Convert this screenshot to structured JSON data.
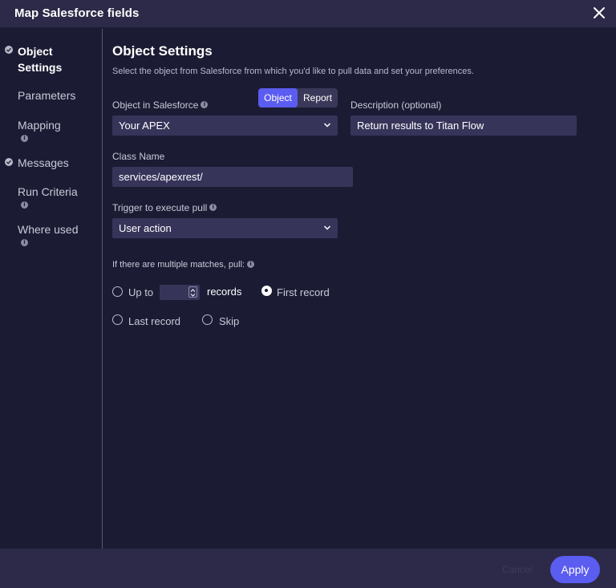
{
  "window": {
    "title": "Map Salesforce fields"
  },
  "sidebar": {
    "items": [
      {
        "label": "Object Settings",
        "checked": true,
        "active": true
      },
      {
        "label": "Parameters"
      },
      {
        "label": "Mapping",
        "info": true
      },
      {
        "label": "Messages",
        "checked": true
      },
      {
        "label": "Run Criteria",
        "info": true
      },
      {
        "label": "Where used",
        "info": true
      }
    ]
  },
  "main": {
    "title": "Object Settings",
    "subtitle": "Select the object from Salesforce from which you'd like to pull data and set your preferences.",
    "object_label": "Object in Salesforce",
    "toggle": {
      "object": "Object",
      "report": "Report",
      "selected": "Object"
    },
    "object_value": "Your APEX",
    "description_label": "Description (optional)",
    "description_value": "Return results to Titan Flow",
    "class_label": "Class Name",
    "class_value": "services/apexrest/",
    "trigger_label": "Trigger to execute pull",
    "trigger_value": "User action",
    "matches_label": "If there are multiple matches, pull:",
    "options": {
      "up_to": "Up to",
      "up_to_value": "",
      "records": "records",
      "first_record": "First record",
      "last_record": "Last record",
      "skip": "Skip",
      "selected": "First record"
    }
  },
  "footer": {
    "cancel": "Cancel",
    "apply": "Apply"
  },
  "colors": {
    "accent": "#5b5cf0",
    "background": "#1b1c34",
    "panel": "#2c2a48",
    "field": "#37345a"
  },
  "icons": {
    "close": "close-icon",
    "check": "check-circle-icon",
    "info": "info-icon",
    "chevron": "chevron-down-icon"
  }
}
